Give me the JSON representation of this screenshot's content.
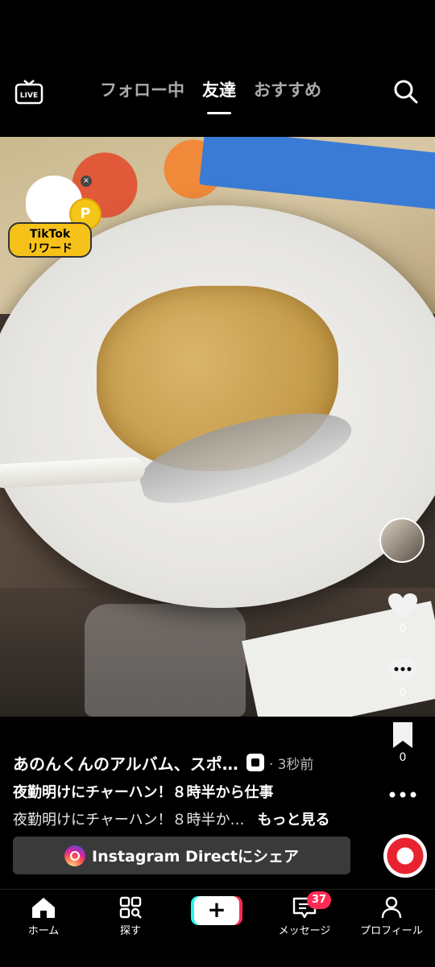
{
  "topnav": {
    "tabs": [
      "フォロー中",
      "友達",
      "おすすめ"
    ],
    "active_tab": "友達",
    "live_label": "LIVE"
  },
  "reward": {
    "coin_label": "P",
    "label_line1": "TikTok",
    "label_line2": "リワード",
    "close": "×"
  },
  "rail": {
    "likes": "0",
    "comments": "0",
    "saves": "0"
  },
  "caption": {
    "author": "あのんくんのアルバム、スポ…",
    "age": "· 3秒前",
    "title": "夜勤明けにチャーハン！８時半から仕事",
    "description": "夜勤明けにチャーハン！８時半か…",
    "more": "もっと見る"
  },
  "share": {
    "label": "Instagram Directにシェア"
  },
  "bottom_nav": {
    "home": "ホーム",
    "explore": "探す",
    "create": "+",
    "messages": "メッセージ",
    "messages_badge": "37",
    "profile": "プロフィール"
  },
  "colors": {
    "accent_red": "#fe2c55",
    "accent_cyan": "#25f4ee",
    "background": "#000000"
  }
}
